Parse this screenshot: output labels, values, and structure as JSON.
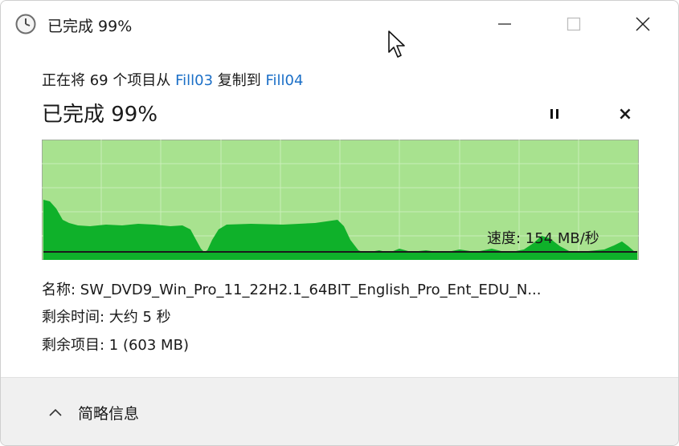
{
  "window": {
    "title": "已完成 99%"
  },
  "copy": {
    "prefix": "正在将 69 个项目从 ",
    "source": "Fill03",
    "middle": " 复制到 ",
    "destination": "Fill04"
  },
  "progress": {
    "title": "已完成 99%",
    "percent": 99,
    "speed_label": "速度: 154 MB/秒",
    "pause_icon": "pause-icon",
    "cancel_symbol": "×"
  },
  "details": {
    "name": "名称: SW_DVD9_Win_Pro_11_22H2.1_64BIT_English_Pro_Ent_EDU_N...",
    "time_remaining": "剩余时间: 大约 5 秒",
    "items_remaining": "剩余项目: 1 (603 MB)"
  },
  "footer": {
    "toggle_label": "简略信息"
  },
  "colors": {
    "graph_bg": "#a8e28f",
    "graph_fill": "#0fb12a",
    "graph_grid": "#c9efb9",
    "link": "#1b6fc7"
  }
}
